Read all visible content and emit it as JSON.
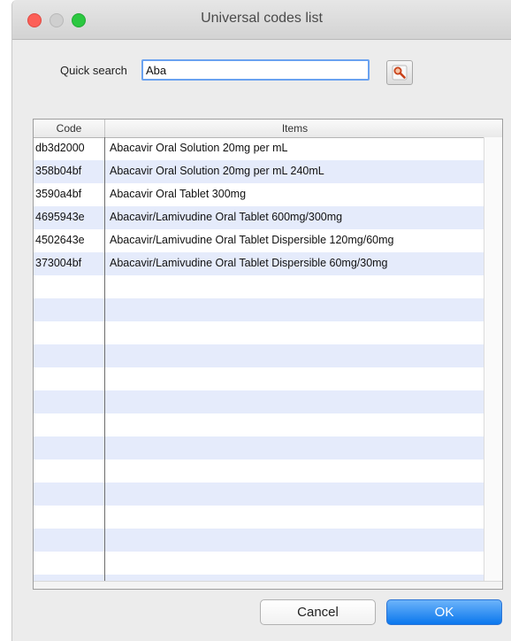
{
  "window": {
    "title": "Universal codes list"
  },
  "search": {
    "label": "Quick search",
    "value": "Aba"
  },
  "table": {
    "headers": {
      "code": "Code",
      "items": "Items"
    },
    "rows": [
      {
        "code": "db3d2000",
        "item": "Abacavir Oral Solution 20mg per mL"
      },
      {
        "code": "358b04bf",
        "item": "Abacavir Oral Solution 20mg per mL 240mL"
      },
      {
        "code": "3590a4bf",
        "item": "Abacavir Oral Tablet 300mg"
      },
      {
        "code": "4695943e",
        "item": "Abacavir/Lamivudine Oral Tablet 600mg/300mg"
      },
      {
        "code": "4502643e",
        "item": "Abacavir/Lamivudine Oral Tablet Dispersible 120mg/60mg"
      },
      {
        "code": "373004bf",
        "item": "Abacavir/Lamivudine Oral Tablet Dispersible 60mg/30mg"
      }
    ]
  },
  "buttons": {
    "cancel": "Cancel",
    "ok": "OK"
  },
  "icons": {
    "search_button": "search-icon"
  },
  "colors": {
    "accent": "#0a77ed",
    "row_stripe": "#e5ebfb",
    "close": "#fc5f57",
    "zoom": "#2bc840"
  }
}
